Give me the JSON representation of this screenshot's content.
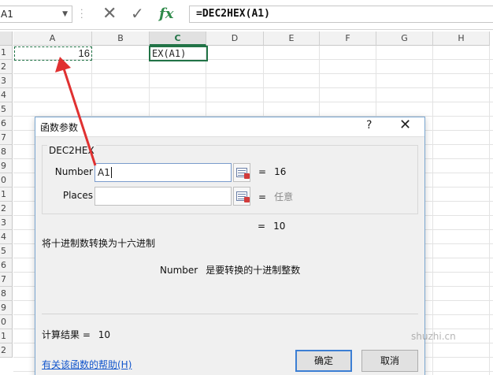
{
  "formula_bar": {
    "name_box": "A1",
    "cancel_icon": "✕",
    "enter_icon": "✓",
    "fx_label": "fx",
    "formula": "=DEC2HEX(A1)"
  },
  "sheet": {
    "columns": [
      "A",
      "B",
      "C",
      "D",
      "E",
      "F",
      "G",
      "H"
    ],
    "selected_column": "C",
    "rows": [
      "1",
      "2",
      "3",
      "4",
      "5",
      "6",
      "7",
      "8",
      "9",
      "0",
      "1",
      "2",
      "3",
      "4",
      "5",
      "6",
      "7",
      "8",
      "9",
      "0",
      "1",
      "2"
    ],
    "cell_a1": "16",
    "cell_c1": "EX(A1)"
  },
  "dialog": {
    "title": "函数参数",
    "help_glyph": "?",
    "close_glyph": "✕",
    "function_name": "DEC2HEX",
    "args": [
      {
        "label": "Number",
        "value": "A1",
        "result": "16"
      },
      {
        "label": "Places",
        "value": "",
        "result": "任意"
      }
    ],
    "equals": "=",
    "formula_result": "10",
    "description": "将十进制数转换为十六进制",
    "arg_desc_name": "Number",
    "arg_desc_text": "是要转换的十进制整数",
    "calc_result_label": "计算结果 =",
    "calc_result_value": "10",
    "help_link": "有关该函数的帮助(H)",
    "ok_label": "确定",
    "cancel_label": "取消"
  },
  "watermark": "shuzhi.cn",
  "colors": {
    "excel_green": "#217346",
    "annotation_red": "#e03131",
    "link_blue": "#1155cc"
  }
}
